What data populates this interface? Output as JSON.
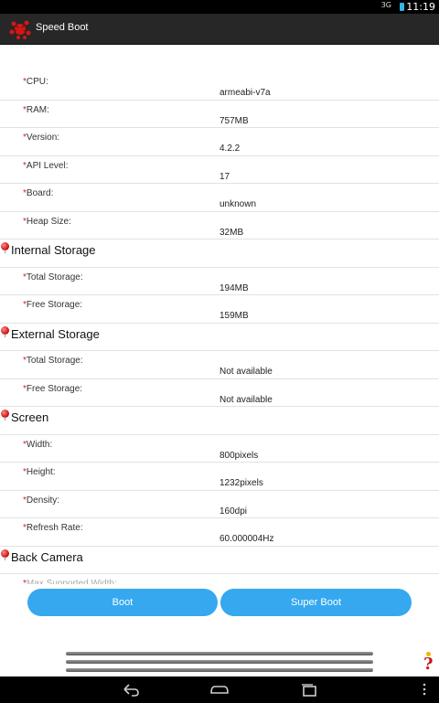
{
  "status_bar": {
    "signal": "3G",
    "time": "11:19"
  },
  "app": {
    "title": "Speed Boot"
  },
  "rows_general": [
    {
      "label": "CPU:",
      "value": "armeabi-v7a"
    },
    {
      "label": "RAM:",
      "value": "757MB"
    },
    {
      "label": "Version:",
      "value": "4.2.2"
    },
    {
      "label": "API Level:",
      "value": "17"
    },
    {
      "label": "Board:",
      "value": "unknown"
    },
    {
      "label": "Heap Size:",
      "value": "32MB"
    }
  ],
  "internal_storage": {
    "title": "Internal Storage",
    "rows": [
      {
        "label": "Total Storage:",
        "value": "194MB"
      },
      {
        "label": "Free Storage:",
        "value": "159MB"
      }
    ]
  },
  "external_storage": {
    "title": "External Storage",
    "rows": [
      {
        "label": "Total Storage:",
        "value": "Not available"
      },
      {
        "label": "Free Storage:",
        "value": "Not available"
      }
    ]
  },
  "screen": {
    "title": "Screen",
    "rows": [
      {
        "label": "Width:",
        "value": "800pixels"
      },
      {
        "label": "Height:",
        "value": "1232pixels"
      },
      {
        "label": "Density:",
        "value": "160dpi"
      },
      {
        "label": "Refresh Rate:",
        "value": "60.000004Hz"
      }
    ]
  },
  "back_camera": {
    "title": "Back Camera",
    "rows": [
      {
        "label": "Max Supported Width:",
        "value": ""
      }
    ]
  },
  "buttons": {
    "boot": "Boot",
    "super_boot": "Super Boot"
  },
  "help_label": "?",
  "star": "*"
}
